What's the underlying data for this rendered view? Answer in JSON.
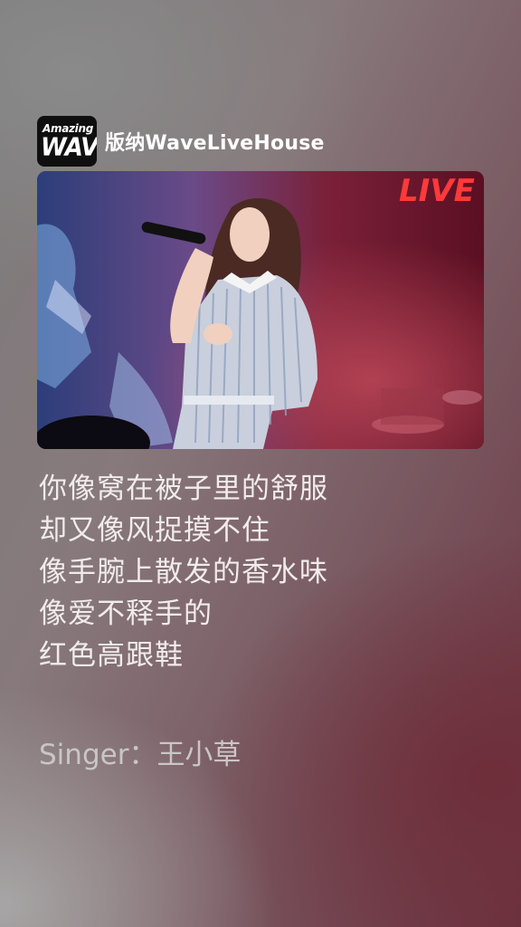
{
  "header": {
    "logo_top": "Amazing",
    "logo_main": "WAVE",
    "venue": "版纳WaveLiveHouse"
  },
  "photo": {
    "sign_text": "LIVE"
  },
  "lyrics": [
    "你像窝在被子里的舒服",
    "却又像风捉摸不住",
    "像手腕上散发的香水味",
    "像爱不释手的",
    "红色高跟鞋"
  ],
  "singer": {
    "label": "Singer：",
    "name": "王小草"
  }
}
